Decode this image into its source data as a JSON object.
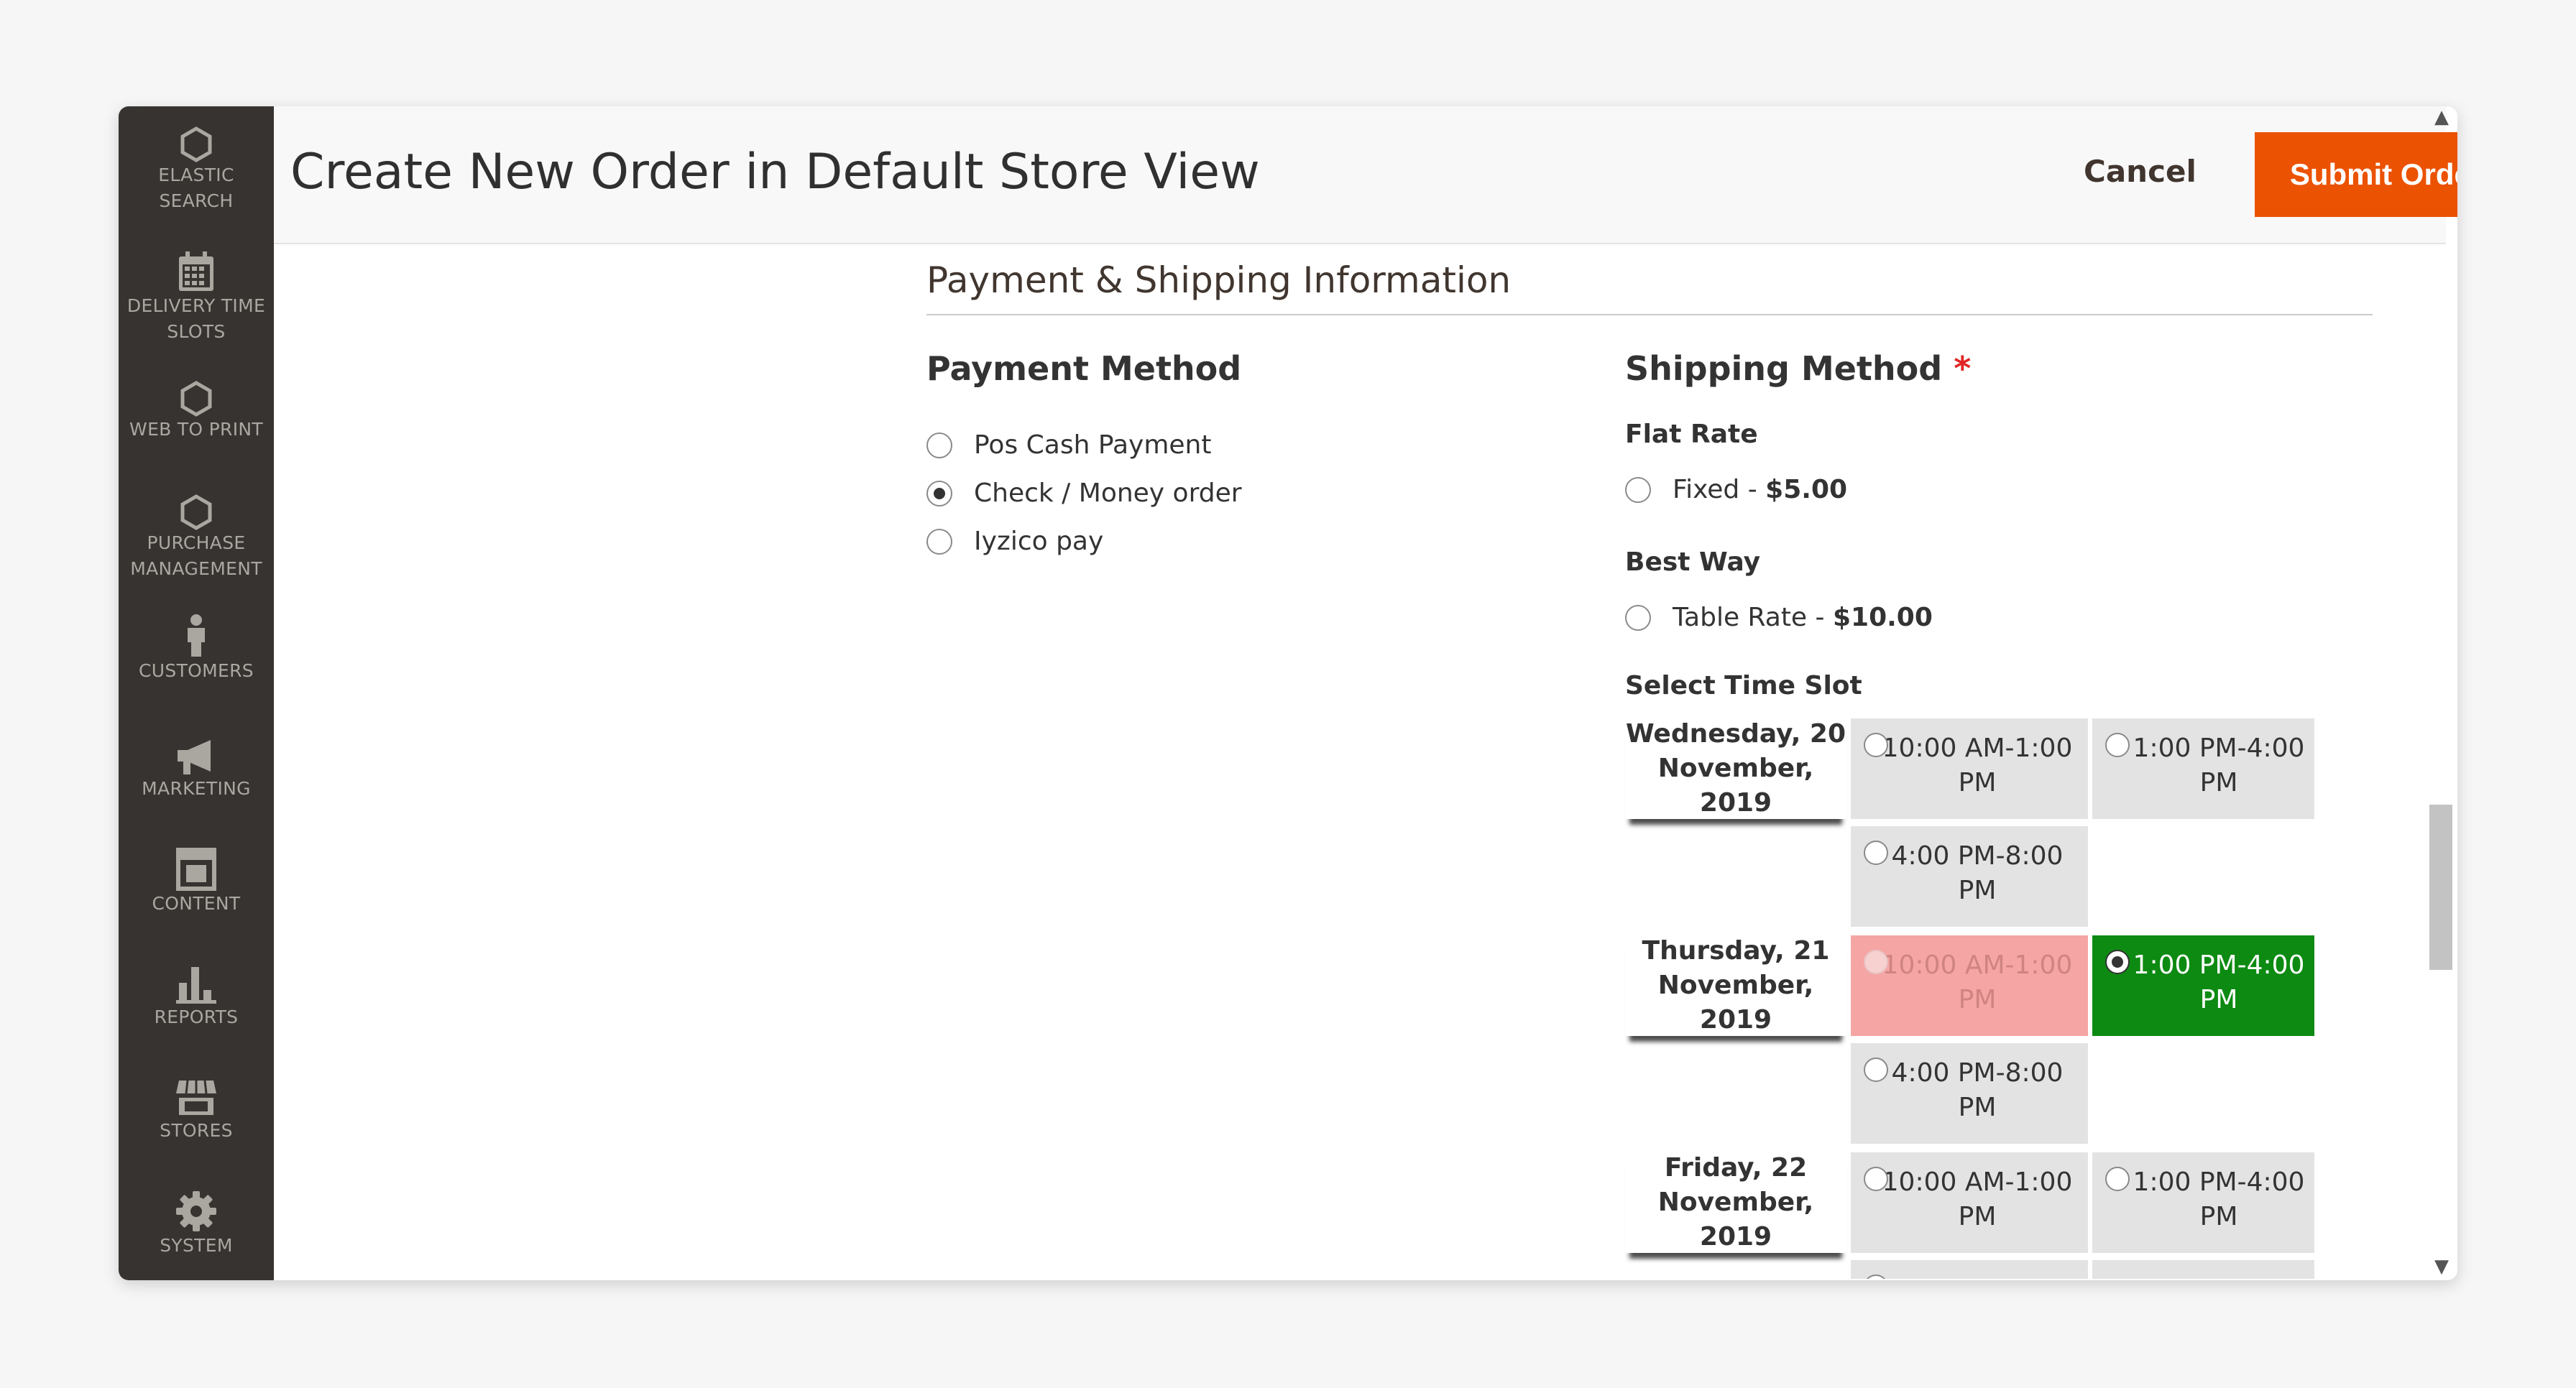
{
  "sidebar": {
    "items": [
      {
        "label_1": "ELASTIC",
        "label_2": "SEARCH",
        "icon": "hexagon-icon"
      },
      {
        "label_1": "DELIVERY TIME",
        "label_2": "SLOTS",
        "icon": "calendar-icon"
      },
      {
        "label_1": "WEB TO PRINT",
        "label_2": "",
        "icon": "hexagon-icon"
      },
      {
        "label_1": "PURCHASE",
        "label_2": "MANAGEMENT",
        "icon": "hexagon-icon"
      },
      {
        "label_1": "CUSTOMERS",
        "label_2": "",
        "icon": "person-icon"
      },
      {
        "label_1": "MARKETING",
        "label_2": "",
        "icon": "megaphone-icon"
      },
      {
        "label_1": "CONTENT",
        "label_2": "",
        "icon": "layout-icon"
      },
      {
        "label_1": "REPORTS",
        "label_2": "",
        "icon": "bar-chart-icon"
      },
      {
        "label_1": "STORES",
        "label_2": "",
        "icon": "storefront-icon"
      },
      {
        "label_1": "SYSTEM",
        "label_2": "",
        "icon": "gear-icon"
      }
    ]
  },
  "header": {
    "title": "Create New Order in Default Store View",
    "cancel_label": "Cancel",
    "submit_label": "Submit Order"
  },
  "section": {
    "title": "Payment & Shipping Information"
  },
  "payment": {
    "title": "Payment Method",
    "options": [
      {
        "label": "Pos Cash Payment",
        "checked": false
      },
      {
        "label": "Check / Money order",
        "checked": true
      },
      {
        "label": "Iyzico pay",
        "checked": false
      }
    ]
  },
  "shipping": {
    "title": "Shipping Method",
    "required_mark": "*",
    "flat_rate": {
      "heading": "Flat Rate",
      "label": "Fixed - ",
      "price": "$5.00"
    },
    "best_way": {
      "heading": "Best Way",
      "label": "Table Rate - ",
      "price": "$10.00"
    },
    "time_slot_heading": "Select Time Slot",
    "days": [
      {
        "date_1": "Wednesday, 20",
        "date_2": "November, 2019",
        "slots": [
          {
            "line_1": "10:00 AM-1:00",
            "line_2": "PM",
            "state": "available"
          },
          {
            "line_1": "1:00 PM-4:00",
            "line_2": "PM",
            "state": "available"
          },
          {
            "line_1": "4:00 PM-8:00",
            "line_2": "PM",
            "state": "available"
          }
        ]
      },
      {
        "date_1": "Thursday, 21",
        "date_2": "November, 2019",
        "slots": [
          {
            "line_1": "10:00 AM-1:00",
            "line_2": "PM",
            "state": "booked"
          },
          {
            "line_1": "1:00 PM-4:00",
            "line_2": "PM",
            "state": "selected"
          },
          {
            "line_1": "4:00 PM-8:00",
            "line_2": "PM",
            "state": "available"
          }
        ]
      },
      {
        "date_1": "Friday, 22",
        "date_2": "November, 2019",
        "slots": [
          {
            "line_1": "10:00 AM-1:00",
            "line_2": "PM",
            "state": "available"
          },
          {
            "line_1": "1:00 PM-4:00",
            "line_2": "PM",
            "state": "available"
          }
        ]
      }
    ]
  },
  "colors": {
    "sidebar_bg": "#373330",
    "submit_bg": "#eb5202",
    "slot_booked": "#f5a5a4",
    "slot_selected": "#0d8a12",
    "slot_available": "#e3e3e3"
  }
}
